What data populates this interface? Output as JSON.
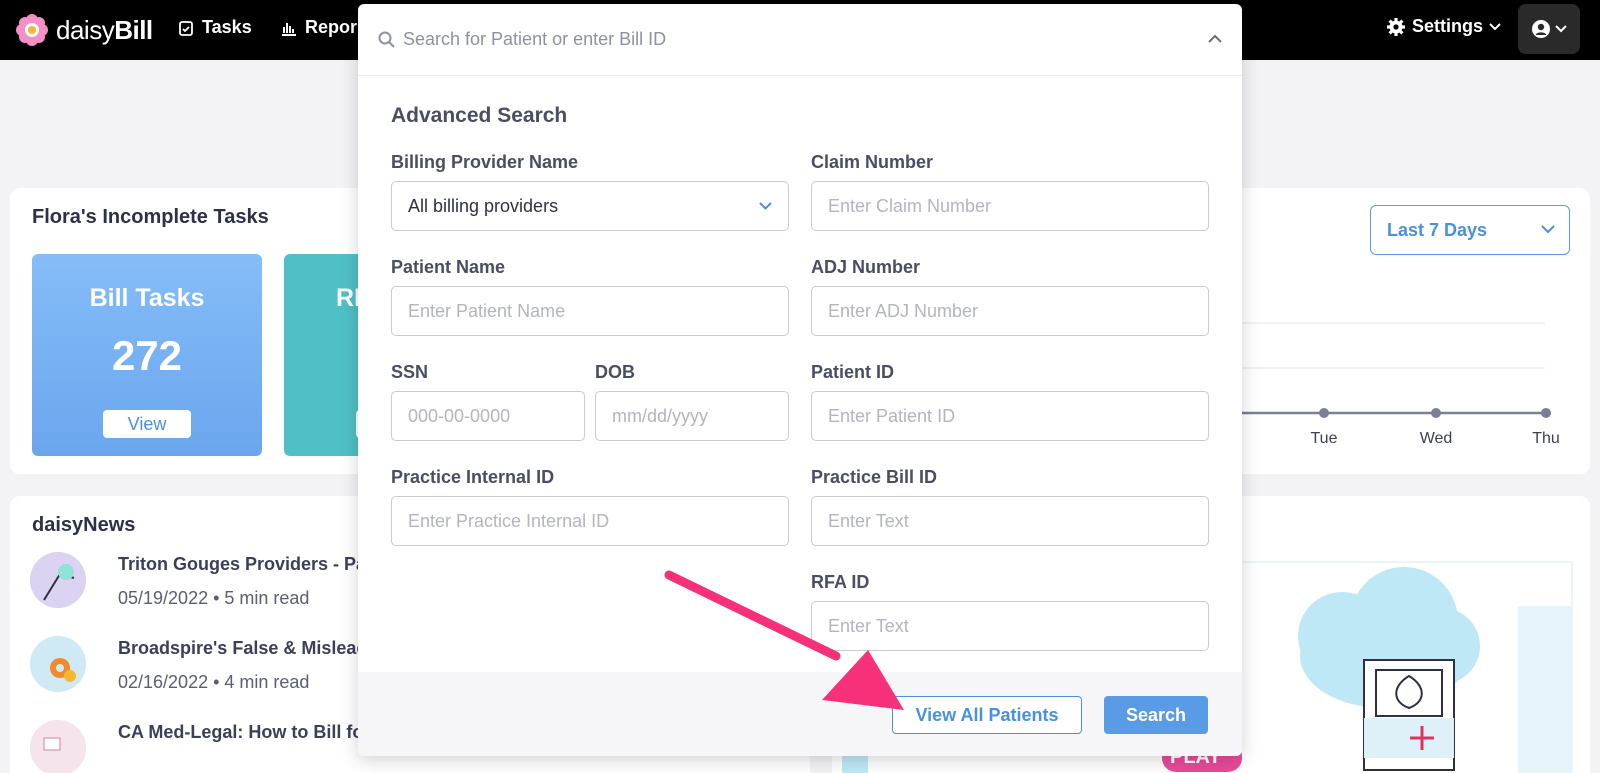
{
  "nav": {
    "brand_light": "daisy",
    "brand_bold": "Bill",
    "tasks_label": "Tasks",
    "reports_label": "Repor",
    "settings_label": "Settings"
  },
  "dashboard": {
    "tasks_title": "Flora's Incomplete Tasks",
    "bill_tile": {
      "label": "Bill Tasks",
      "count": "272",
      "view": "View"
    },
    "rfa_tile": {
      "label": "RI"
    },
    "date_range": "Last 7 Days",
    "chart_days": [
      "Tue",
      "Wed",
      "Thu"
    ],
    "news_title": "daisyNews",
    "news": [
      {
        "headline": "Triton Gouges Providers - Pay",
        "meta": "05/19/2022 • 5 min read"
      },
      {
        "headline": "Broadspire's False & Misleadi",
        "meta": "02/16/2022 • 4 min read"
      },
      {
        "headline": "CA Med-Legal: How to Bill for",
        "meta": ""
      }
    ],
    "promo_badge": "PLAY"
  },
  "search": {
    "placeholder": "Search for Patient or enter Bill ID",
    "advanced_title": "Advanced Search",
    "fields": {
      "billing_provider": {
        "label": "Billing Provider Name",
        "value": "All billing providers"
      },
      "claim_number": {
        "label": "Claim Number",
        "placeholder": "Enter Claim Number"
      },
      "patient_name": {
        "label": "Patient Name",
        "placeholder": "Enter Patient Name"
      },
      "adj_number": {
        "label": "ADJ Number",
        "placeholder": "Enter ADJ Number"
      },
      "ssn": {
        "label": "SSN",
        "placeholder": "000-00-0000"
      },
      "dob": {
        "label": "DOB",
        "placeholder": "mm/dd/yyyy"
      },
      "patient_id": {
        "label": "Patient ID",
        "placeholder": "Enter Patient ID"
      },
      "practice_internal_id": {
        "label": "Practice Internal ID",
        "placeholder": "Enter Practice Internal ID"
      },
      "practice_bill_id": {
        "label": "Practice Bill ID",
        "placeholder": "Enter Text"
      },
      "rfa_id": {
        "label": "RFA ID",
        "placeholder": "Enter Text"
      }
    },
    "view_all_label": "View All Patients",
    "search_label": "Search"
  },
  "colors": {
    "accent": "#4a90e2",
    "arrow": "#f7307a",
    "bill_tile": "#7ab2f4",
    "rfa_tile": "#4fc0c5"
  }
}
